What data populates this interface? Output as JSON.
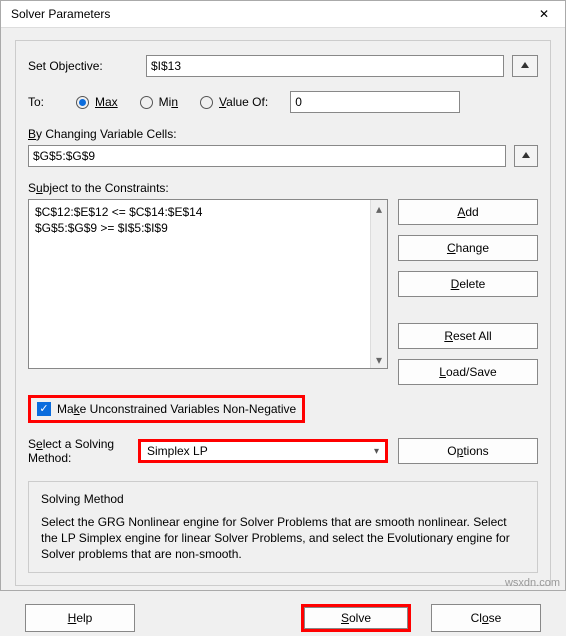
{
  "title": "Solver Parameters",
  "labels": {
    "set_objective": "Set Objective:",
    "to": "To:",
    "max": "Max",
    "min": "Min",
    "value_of": "Value Of:",
    "by_changing": "By Changing Variable Cells:",
    "subject_to": "Subject to the Constraints:",
    "make_unconstrained": "Make Unconstrained Variables Non-Negative",
    "select_method": "Select a Solving Method:",
    "solving_method_title": "Solving Method",
    "solving_method_desc": "Select the GRG Nonlinear engine for Solver Problems that are smooth nonlinear. Select the LP Simplex engine for linear Solver Problems, and select the Evolutionary engine for Solver problems that are non-smooth."
  },
  "inputs": {
    "objective": "$I$13",
    "value_of_value": "0",
    "changing_cells": "$G$5:$G$9",
    "constraints": [
      "$C$12:$E$12 <= $C$14:$E$14",
      "$G$5:$G$9 >= $I$5:$I$9"
    ],
    "method": "Simplex LP",
    "make_unconstrained_checked": true,
    "to_selected": "max"
  },
  "buttons": {
    "add": "Add",
    "change": "Change",
    "delete": "Delete",
    "reset_all": "Reset All",
    "load_save": "Load/Save",
    "options": "Options",
    "help": "Help",
    "solve": "Solve",
    "close": "Close"
  },
  "watermark": "wsxdn.com"
}
